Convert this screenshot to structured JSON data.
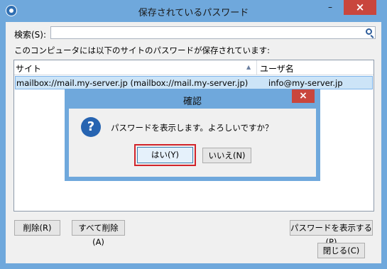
{
  "window": {
    "title": "保存されているパスワード",
    "minimize": "–",
    "close": "×"
  },
  "search": {
    "label": "検索(S):",
    "value": ""
  },
  "info_text": "このコンピュータには以下のサイトのパスワードが保存されています:",
  "table": {
    "columns": [
      "サイト",
      "ユーザ名"
    ],
    "rows": [
      {
        "site": "mailbox://mail.my-server.jp (mailbox://mail.my-server.jp)",
        "user": "info@my-server.jp"
      }
    ]
  },
  "buttons": {
    "delete": "削除(R)",
    "delete_all": "すべて削除(A)",
    "show_passwords": "パスワードを表示する(P)",
    "close": "閉じる(C)"
  },
  "dialog": {
    "title": "確認",
    "close": "×",
    "message": "パスワードを表示します。よろしいですか？",
    "yes": "はい(Y)",
    "no": "いいえ(N)"
  },
  "icons": {
    "app": "app-icon",
    "search": "search-icon",
    "question": "question-icon",
    "sort": "sort-ascending-icon"
  },
  "colors": {
    "titlebar": "#6fa8dc",
    "close_button": "#c9463d",
    "selection": "#cce4f7",
    "highlight_frame": "#d1232a"
  }
}
